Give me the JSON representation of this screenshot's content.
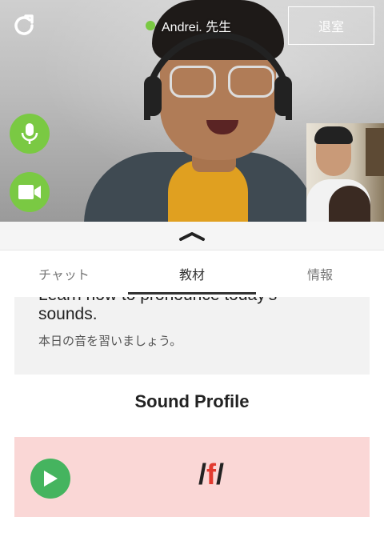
{
  "header": {
    "teacher_name": "Andrei. 先生",
    "leave_label": "退室",
    "online_color": "#7ac943"
  },
  "controls": {
    "refresh_icon": "refresh-icon",
    "mic_icon": "microphone-icon",
    "camera_icon": "video-camera-icon",
    "button_color": "#7ac943"
  },
  "tabs": [
    {
      "label": "チャット",
      "active": false
    },
    {
      "label": "教材",
      "active": true
    },
    {
      "label": "情報",
      "active": false
    }
  ],
  "lesson": {
    "cut_line": "Learn how to pronounce today's",
    "english": "sounds.",
    "japanese": "本日の音を習いましょう。"
  },
  "sound_profile": {
    "title": "Sound Profile",
    "open": "/",
    "letter": "f",
    "close": "/",
    "accent_color": "#e23a2f",
    "play_color": "#45b45f"
  }
}
